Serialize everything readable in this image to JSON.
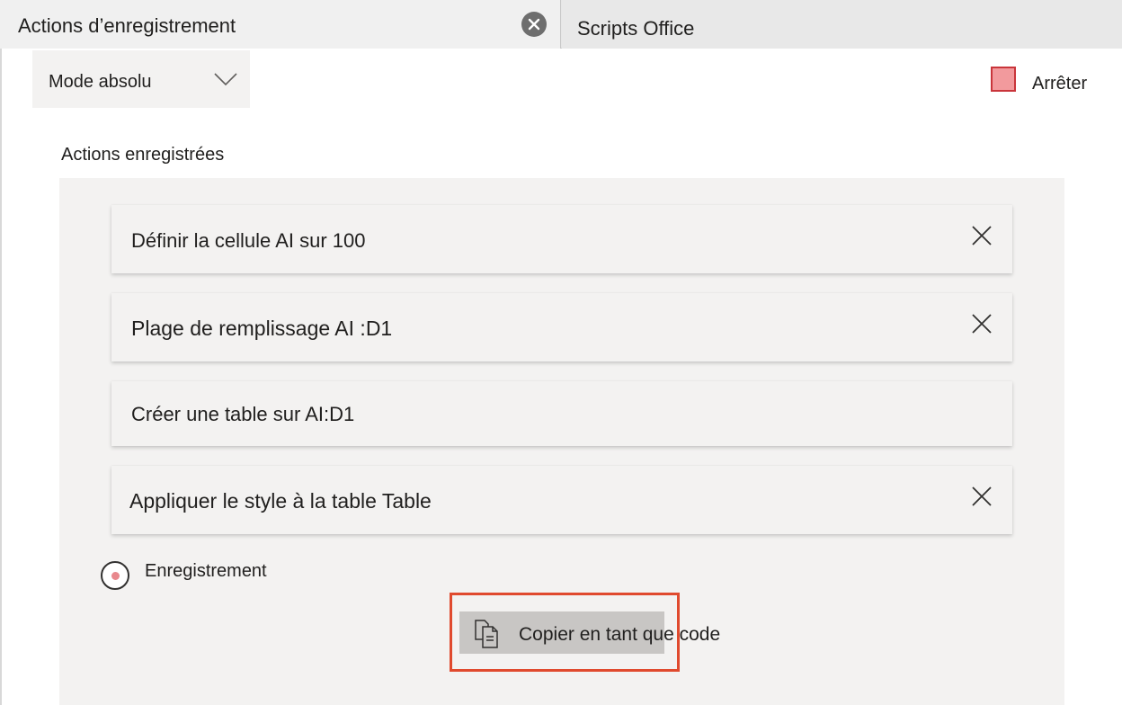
{
  "tabs": [
    {
      "label": "Actions d’enregistrement",
      "active": true
    },
    {
      "label": "Scripts Office",
      "active": false
    }
  ],
  "toolbar": {
    "mode_label": "Mode absolu",
    "stop_label": "Arrêter"
  },
  "section_title": "Actions enregistrées",
  "actions": [
    {
      "label": "Définir la cellule AI sur 100",
      "deletable": true
    },
    {
      "label": "Plage de remplissage AI :D1",
      "deletable": true
    },
    {
      "label": "Créer une table sur AI:D1",
      "deletable": false
    },
    {
      "label": "Appliquer le style à la table Table",
      "deletable": true
    }
  ],
  "status": {
    "recording_label": "Enregistrement"
  },
  "copy_button": {
    "label": "Copier en tant que code"
  },
  "colors": {
    "stop_fill": "#f29a9d",
    "stop_border": "#c9353b",
    "highlight": "#e04a2e",
    "panel_bg": "#f3f2f1",
    "button_bg": "#c8c6c4"
  }
}
